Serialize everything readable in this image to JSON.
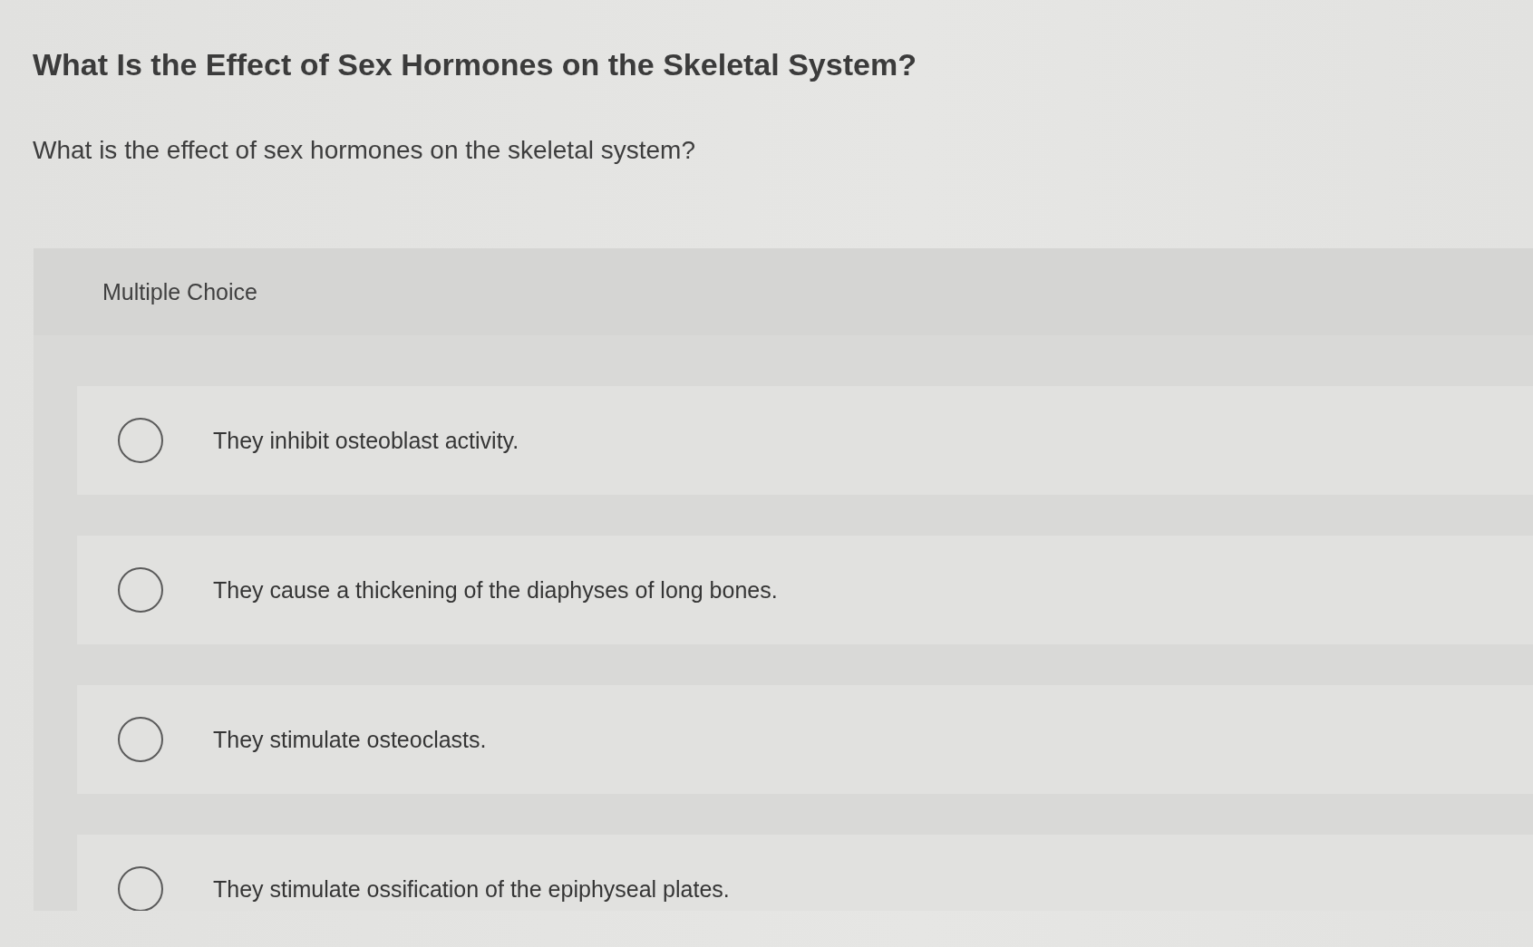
{
  "title": "What Is the Effect of Sex Hormones on the Skeletal System?",
  "question": "What is the effect of sex hormones on the skeletal system?",
  "answer_panel": {
    "label": "Multiple Choice",
    "options": [
      {
        "text": "They inhibit osteoblast activity.",
        "selected": false
      },
      {
        "text": "They cause a thickening of the diaphyses of long bones.",
        "selected": false
      },
      {
        "text": "They stimulate osteoclasts.",
        "selected": false
      },
      {
        "text": "They stimulate ossification of the epiphyseal plates.",
        "selected": false
      }
    ]
  }
}
